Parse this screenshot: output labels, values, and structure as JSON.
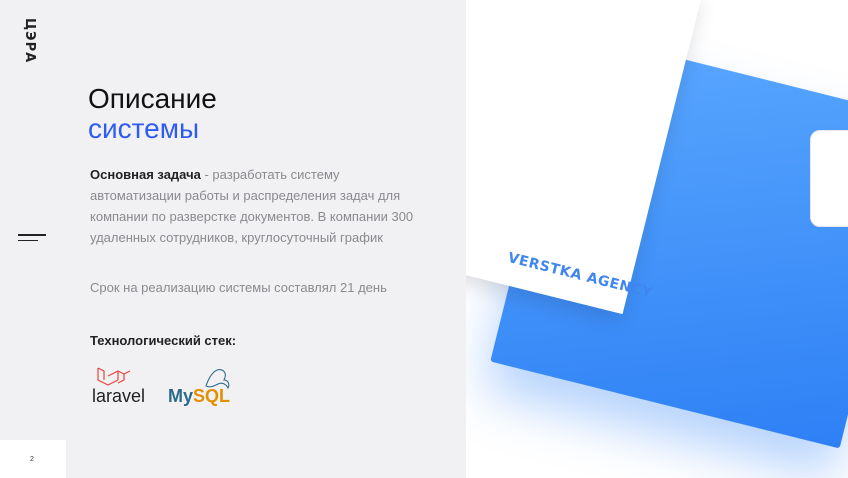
{
  "logo_text": "ЦЭРА",
  "title": {
    "line1": "Описание",
    "line2": "системы"
  },
  "description": {
    "bold": "Основная задача",
    "text": " - разработать систему автоматизации работы и распределения задач для компании по разверстке документов. В компании 300 удаленных сотрудников, круглосуточный график"
  },
  "deadline": "Срок на реализацию системы составлял 21 день",
  "stack_title": "Технологический стек:",
  "tech": {
    "laravel": "laravel",
    "mysql_my": "My",
    "mysql_sql": "SQL"
  },
  "brand_text": "VERSTKA AGENCY",
  "page_number": "2",
  "colors": {
    "accent": "#2f5cf0",
    "folder": "#3f8ef7",
    "left_bg": "#f1f1f4"
  }
}
